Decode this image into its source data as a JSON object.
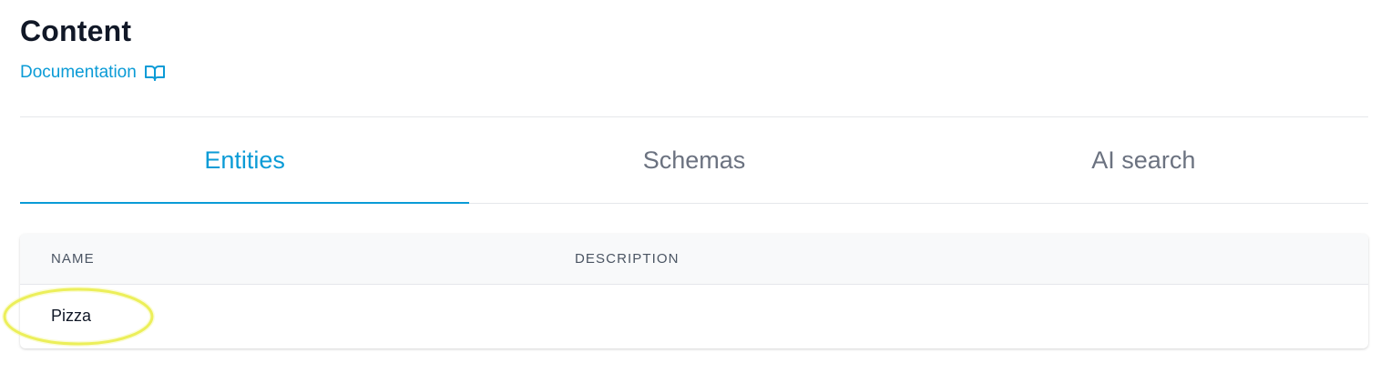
{
  "header": {
    "title": "Content",
    "documentation_link": "Documentation",
    "documentation_icon": "book-open-icon"
  },
  "tabs": [
    {
      "label": "Entities",
      "active": true
    },
    {
      "label": "Schemas",
      "active": false
    },
    {
      "label": "AI search",
      "active": false
    }
  ],
  "table": {
    "columns": [
      "NAME",
      "DESCRIPTION"
    ],
    "rows": [
      {
        "name": "Pizza",
        "description": ""
      }
    ]
  },
  "colors": {
    "accent": "#0a9bd6",
    "highlight": "#e6ea2c"
  }
}
